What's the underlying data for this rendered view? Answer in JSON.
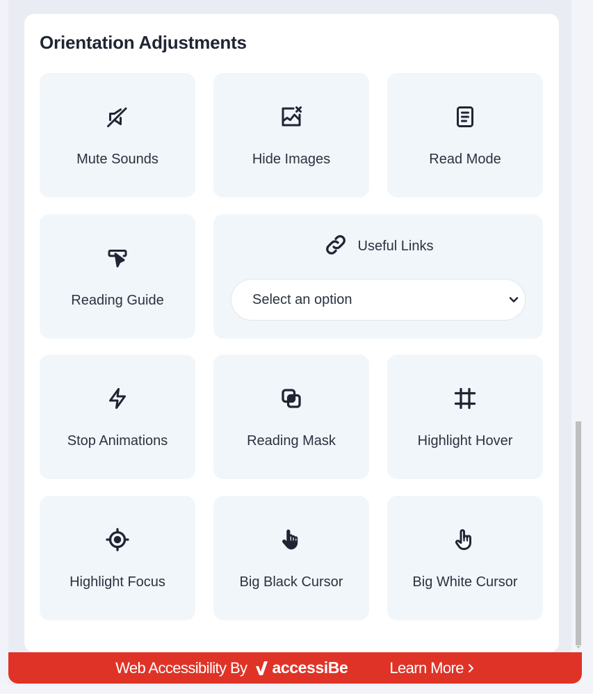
{
  "section": {
    "title": "Orientation Adjustments"
  },
  "tiles": [
    {
      "label": "Mute Sounds",
      "icon": "mute-icon"
    },
    {
      "label": "Hide Images",
      "icon": "hide-image-icon"
    },
    {
      "label": "Read Mode",
      "icon": "document-icon"
    },
    {
      "label": "Reading Guide",
      "icon": "reading-guide-icon"
    },
    {
      "label": "Stop Animations",
      "icon": "lightning-icon"
    },
    {
      "label": "Reading Mask",
      "icon": "overlap-squares-icon"
    },
    {
      "label": "Highlight Hover",
      "icon": "hash-frame-icon"
    },
    {
      "label": "Highlight Focus",
      "icon": "crosshair-icon"
    },
    {
      "label": "Big Black Cursor",
      "icon": "hand-pointer-filled-icon"
    },
    {
      "label": "Big White Cursor",
      "icon": "hand-pointer-outline-icon"
    }
  ],
  "useful_links": {
    "label": "Useful Links",
    "icon": "link-icon",
    "select_value": "Select an option"
  },
  "footer": {
    "by_text": "Web Accessibility By",
    "brand": "accessiBe",
    "learn_more": "Learn More",
    "color": "#df3327"
  }
}
